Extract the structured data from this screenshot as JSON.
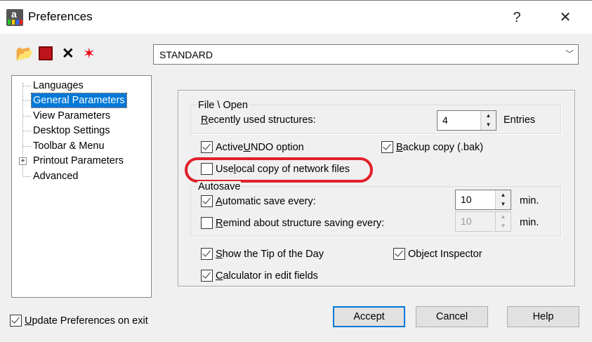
{
  "window": {
    "title": "Preferences",
    "help": "?",
    "close": "✕"
  },
  "toolbar": {
    "profile": "STANDARD"
  },
  "tree": [
    "Languages",
    "General Parameters",
    "View Parameters",
    "Desktop Settings",
    "Toolbar & Menu",
    "Printout Parameters",
    "Advanced"
  ],
  "file_open": {
    "title": "File \\ Open",
    "recent": [
      "",
      "R",
      "ecently used structures:"
    ],
    "recent_value": "4",
    "entries": "Entries"
  },
  "undo": [
    "Active ",
    "U",
    "NDO option"
  ],
  "backup": [
    "",
    "B",
    "ackup copy (.bak)"
  ],
  "local_copy": [
    "Use ",
    "l",
    "ocal copy of network files"
  ],
  "autosave": {
    "title": "Autosave",
    "auto": [
      "",
      "A",
      "utomatic save every:"
    ],
    "auto_value": "10",
    "remind": [
      "",
      "R",
      "emind about structure saving every:"
    ],
    "remind_value": "10",
    "unit": "min."
  },
  "tip": [
    "",
    "S",
    "how the Tip of the Day"
  ],
  "inspector": "Object Inspector",
  "calc": [
    "",
    "C",
    "alculator in edit fields"
  ],
  "update": [
    "",
    "U",
    "pdate Preferences on exit"
  ],
  "buttons": {
    "accept": "Accept",
    "cancel": "Cancel",
    "help": "Help"
  },
  "colors": {
    "highlight": "#e0202a",
    "selection": "#0078d7"
  }
}
